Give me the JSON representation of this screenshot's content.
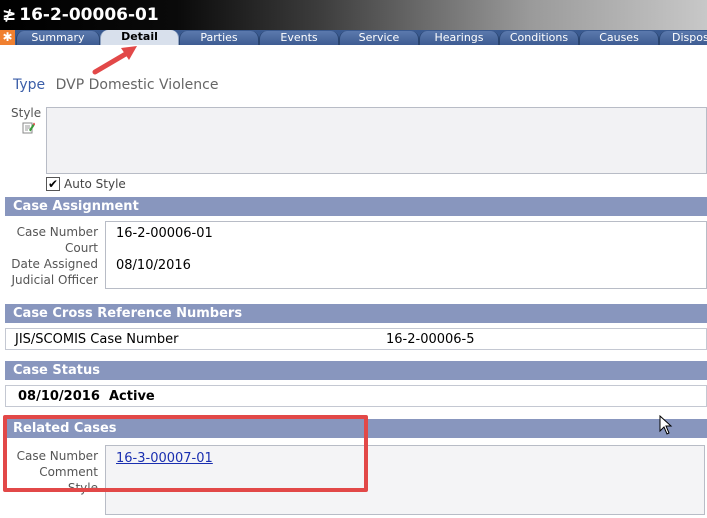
{
  "window": {
    "title": "16-2-00006-01"
  },
  "tabs": [
    {
      "label": "Summary"
    },
    {
      "label": "Detail"
    },
    {
      "label": "Parties"
    },
    {
      "label": "Events"
    },
    {
      "label": "Service"
    },
    {
      "label": "Hearings"
    },
    {
      "label": "Conditions"
    },
    {
      "label": "Causes"
    },
    {
      "label": "Dispositions"
    }
  ],
  "active_tab": "Detail",
  "detail": {
    "type_label": "Type",
    "type_value": "DVP Domestic Violence",
    "style_label": "Style",
    "style_value": "",
    "auto_style_label": "Auto Style",
    "auto_style_checked": true
  },
  "case_assignment": {
    "header": "Case Assignment",
    "case_number_label": "Case Number",
    "case_number": "16-2-00006-01",
    "court_label": "Court",
    "court": "",
    "date_assigned_label": "Date Assigned",
    "date_assigned": "08/10/2016",
    "judicial_officer_label": "Judicial Officer",
    "judicial_officer": ""
  },
  "cross_reference": {
    "header": "Case Cross Reference Numbers",
    "rows": [
      {
        "label": "JIS/SCOMIS Case Number",
        "value": "16-2-00006-5"
      }
    ]
  },
  "case_status": {
    "header": "Case Status",
    "date": "08/10/2016",
    "status": "Active"
  },
  "related_cases": {
    "header": "Related Cases",
    "case_number_label": "Case Number",
    "case_number": "16-3-00007-01",
    "comment_label": "Comment",
    "style_label": "Style"
  },
  "colors": {
    "section_header": "#8896be",
    "tab_strip": "#3a5a90",
    "annotation_red": "#e24848",
    "type_label": "#3b5ea8",
    "link": "#1a2fb0"
  }
}
